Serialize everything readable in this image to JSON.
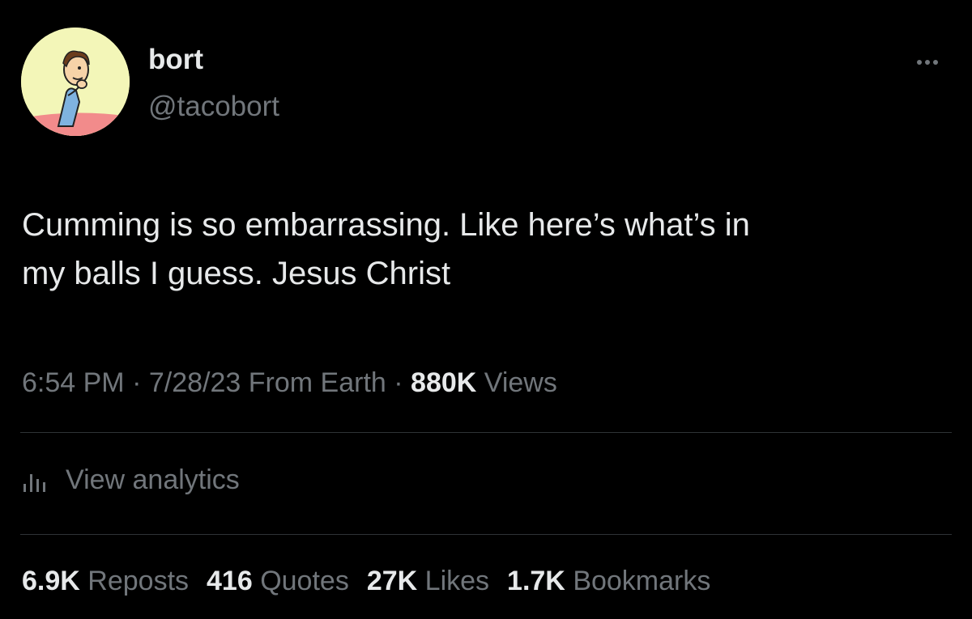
{
  "author": {
    "display_name": "bort",
    "handle": "@tacobort",
    "avatar_icon": "cartoon-character-avatar"
  },
  "header": {
    "more_icon": "more-dots-icon"
  },
  "tweet": {
    "text_line1": "Cumming is so embarrassing. Like here’s what’s in",
    "text_line2": "my balls I guess. Jesus Christ"
  },
  "meta": {
    "time": "6:54 PM",
    "sep1": "·",
    "date": "7/28/23",
    "source": "From Earth",
    "sep2": "·",
    "views_count": "880K",
    "views_label": "Views"
  },
  "analytics": {
    "label": "View analytics",
    "icon": "analytics-bars-icon"
  },
  "stats": [
    {
      "count": "6.9K",
      "label": "Reposts"
    },
    {
      "count": "416",
      "label": "Quotes"
    },
    {
      "count": "27K",
      "label": "Likes"
    },
    {
      "count": "1.7K",
      "label": "Bookmarks"
    }
  ],
  "colors": {
    "background": "#000000",
    "primary_text": "#e7e9ea",
    "secondary_text": "#71767b",
    "divider": "#2f3336",
    "avatar_background": "#f3f6b8"
  }
}
